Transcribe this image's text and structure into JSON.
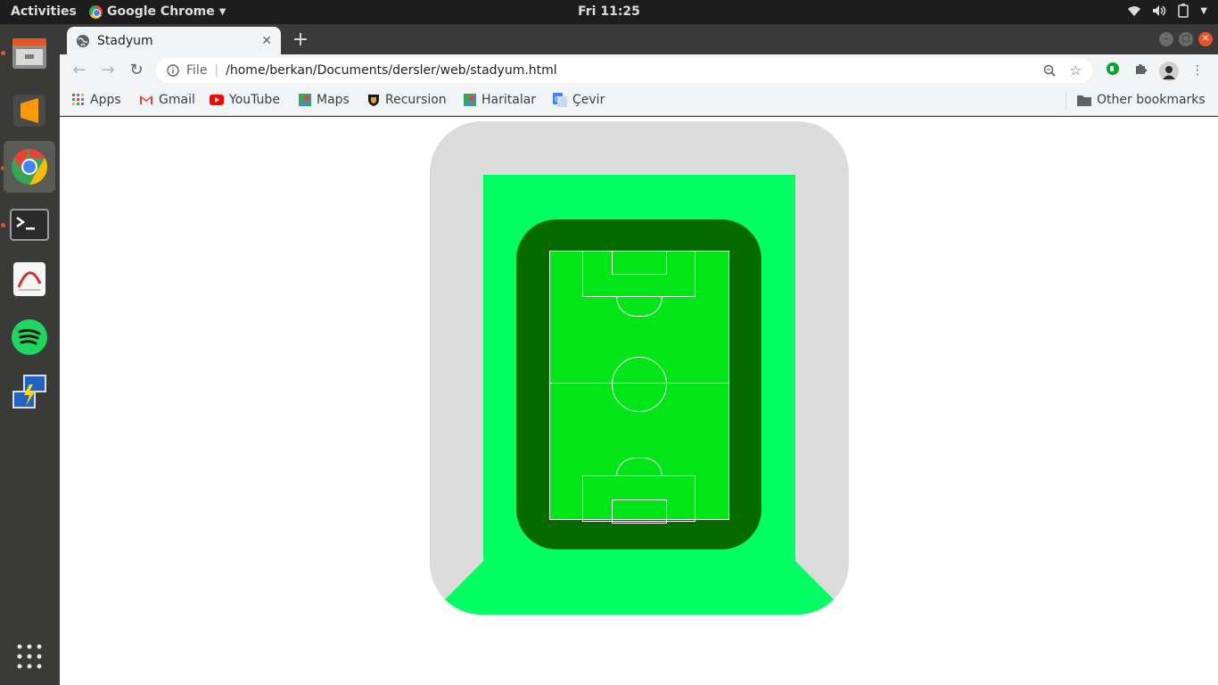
{
  "system": {
    "activities": "Activities",
    "app_name": "Google Chrome",
    "clock": "Fri 11:25"
  },
  "dock": {
    "items": [
      "files-icon",
      "sublime-text-icon",
      "chrome-icon",
      "terminal-icon",
      "document-viewer-icon",
      "spotify-icon",
      "remote-desktop-icon",
      "app-grid-icon"
    ]
  },
  "browser": {
    "tab_title": "Stadyum",
    "address_scheme": "File",
    "address_url": "/home/berkan/Documents/dersler/web/stadyum.html",
    "bookmarks": [
      "Apps",
      "Gmail",
      "YouTube",
      "Maps",
      "Recursion",
      "Haritalar",
      "Çevir"
    ],
    "other_bookmarks": "Other bookmarks"
  },
  "colors": {
    "stadium_outer": "#dcdcdc",
    "stands": "#00ff63",
    "track": "#056b00",
    "pitch": "#00e617",
    "accent": "#e95420"
  }
}
